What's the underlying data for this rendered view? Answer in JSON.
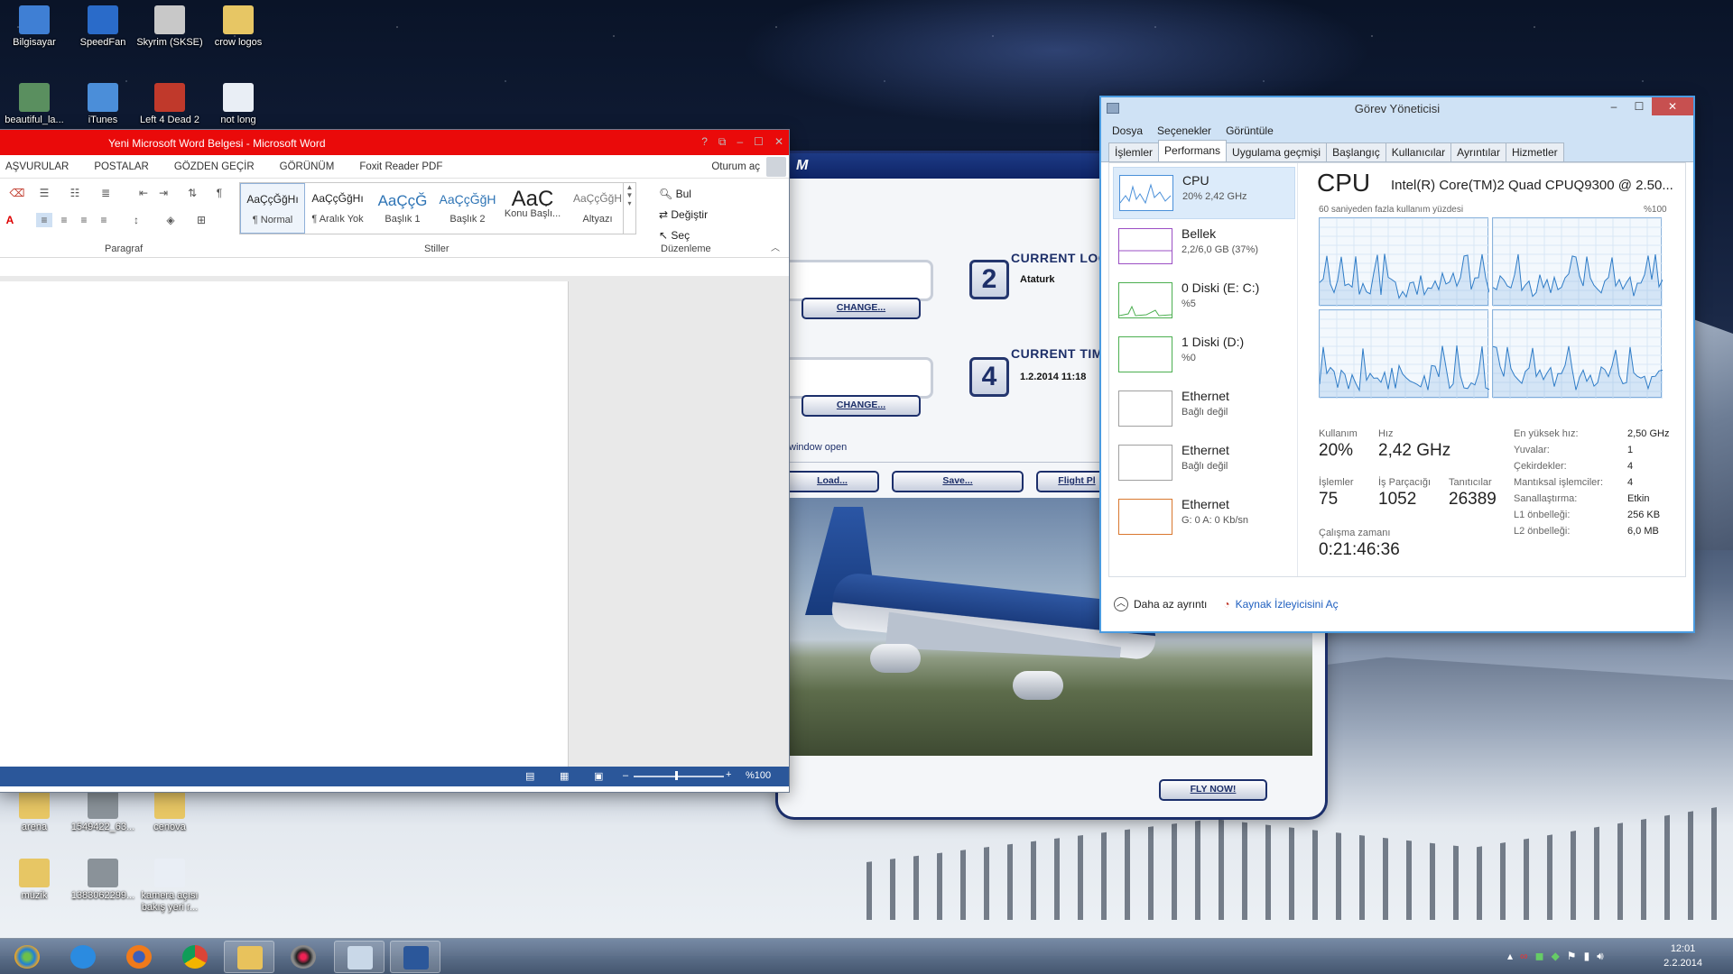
{
  "desktop": {
    "icons_top": [
      {
        "label": "Bilgisayar",
        "color": "#3f7fd4"
      },
      {
        "label": "SpeedFan",
        "color": "#2a6bc9"
      },
      {
        "label": "Skyrim (SKSE)",
        "color": "#c8c8c8"
      },
      {
        "label": "crow logos",
        "color": "#e7c664"
      },
      {
        "label": "beautiful_la...",
        "color": "#5a8f5f"
      },
      {
        "label": "iTunes",
        "color": "#4b8ed9"
      },
      {
        "label": "Left 4 Dead 2",
        "color": "#c0392b"
      },
      {
        "label": "not long",
        "color": "#e9eef5"
      }
    ],
    "icons_bottom": [
      {
        "label": "arena",
        "color": "#e7c664"
      },
      {
        "label": "1549422_63...",
        "color": "#8a9299"
      },
      {
        "label": "cenova",
        "color": "#e7c664"
      },
      {
        "label": "müzik",
        "color": "#e7c664"
      },
      {
        "label": "1383062299...",
        "color": "#8a9299"
      },
      {
        "label": "kamera açısı bakış yeri r...",
        "color": "#e9eef5"
      }
    ]
  },
  "word": {
    "title": "Yeni Microsoft Word Belgesi - Microsoft Word",
    "title_buttons": [
      "?",
      "⧉",
      "–",
      "☐",
      "✕"
    ],
    "tabs": [
      "AŞVURULAR",
      "POSTALAR",
      "GÖZDEN GEÇİR",
      "GÖRÜNÜM",
      "Foxit Reader PDF"
    ],
    "sign_in": "Oturum aç",
    "groups": {
      "paragraph": "Paragraf",
      "styles": "Stiller",
      "editing": "Düzenleme"
    },
    "styles": [
      {
        "preview": "AaÇçĞğHı",
        "name": "¶ Normal"
      },
      {
        "preview": "AaÇçĞğHı",
        "name": "¶ Aralık Yok"
      },
      {
        "preview": "AaÇçĞ",
        "name": "Başlık 1"
      },
      {
        "preview": "AaÇçĞğH",
        "name": "Başlık 2"
      },
      {
        "preview": "AaÇ",
        "name": "Konu Başlı..."
      },
      {
        "preview": "AaÇçĞğH",
        "name": "Altyazı"
      }
    ],
    "editing": {
      "find": "Bul",
      "replace": "Değiştir",
      "select": "Seç"
    },
    "zoom": "%100"
  },
  "fsx": {
    "header": "M",
    "location_num": "2",
    "location_title": "CURRENT LOCA",
    "location_value": "Ataturk",
    "time_num": "4",
    "time_title": "CURRENT TIME",
    "time_value": "1.2.2014 11:18",
    "change_label": "CHANGE...",
    "window_open": "window open",
    "load": "Load...",
    "save": "Save...",
    "flight_plan": "Flight Pl",
    "fly_now": "FLY NOW!"
  },
  "taskmgr": {
    "title": "Görev Yöneticisi",
    "window_buttons": [
      "–",
      "☐",
      "✕"
    ],
    "menu": [
      "Dosya",
      "Seçenekler",
      "Görüntüle"
    ],
    "tabs": [
      "İşlemler",
      "Performans",
      "Uygulama geçmişi",
      "Başlangıç",
      "Kullanıcılar",
      "Ayrıntılar",
      "Hizmetler"
    ],
    "active_tab": "Performans",
    "sidebar": [
      {
        "name": "CPU",
        "sub": "20% 2,42 GHz",
        "color": "#4a90d9"
      },
      {
        "name": "Bellek",
        "sub": "2,2/6,0 GB (37%)",
        "color": "#9b4fc4"
      },
      {
        "name": "0 Diski (E: C:)",
        "sub": "%5",
        "color": "#4caf50"
      },
      {
        "name": "1 Diski (D:)",
        "sub": "%0",
        "color": "#4caf50"
      },
      {
        "name": "Ethernet",
        "sub": "Bağlı değil",
        "color": "#a0a0a0"
      },
      {
        "name": "Ethernet",
        "sub": "Bağlı değil",
        "color": "#a0a0a0"
      },
      {
        "name": "Ethernet",
        "sub": "G: 0 A: 0 Kb/sn",
        "color": "#d9772e"
      }
    ],
    "cpu": {
      "heading": "CPU",
      "model": "Intel(R) Core(TM)2 Quad CPUQ9300 @ 2.50...",
      "graph_caption": "60 saniyeden fazla kullanım yüzdesi",
      "graph_max": "%100",
      "usage_label": "Kullanım",
      "usage": "20%",
      "speed_label": "Hız",
      "speed": "2,42 GHz",
      "processes_label": "İşlemler",
      "processes": "75",
      "threads_label": "İş Parçacığı",
      "threads": "1052",
      "handles_label": "Tanıtıcılar",
      "handles": "26389",
      "uptime_label": "Çalışma zamanı",
      "uptime": "0:21:46:36",
      "specs": [
        {
          "k": "En yüksek hız:",
          "v": "2,50 GHz"
        },
        {
          "k": "Yuvalar:",
          "v": "1"
        },
        {
          "k": "Çekirdekler:",
          "v": "4"
        },
        {
          "k": "Mantıksal işlemciler:",
          "v": "4"
        },
        {
          "k": "Sanallaştırma:",
          "v": "Etkin"
        },
        {
          "k": "L1 önbelleği:",
          "v": "256 KB"
        },
        {
          "k": "L2 önbelleği:",
          "v": "6,0 MB"
        }
      ]
    },
    "footer": {
      "less": "Daha az ayrıntı",
      "resmon": "Kaynak İzleyicisini Aç"
    }
  },
  "taskbar": {
    "items": [
      "start-button",
      "ie-icon",
      "firefox-icon",
      "chrome-icon",
      "explorer-icon",
      "media-icon",
      "taskmgr-icon",
      "word-icon"
    ],
    "clock_time": "12:01",
    "clock_date": "2.2.2014"
  }
}
